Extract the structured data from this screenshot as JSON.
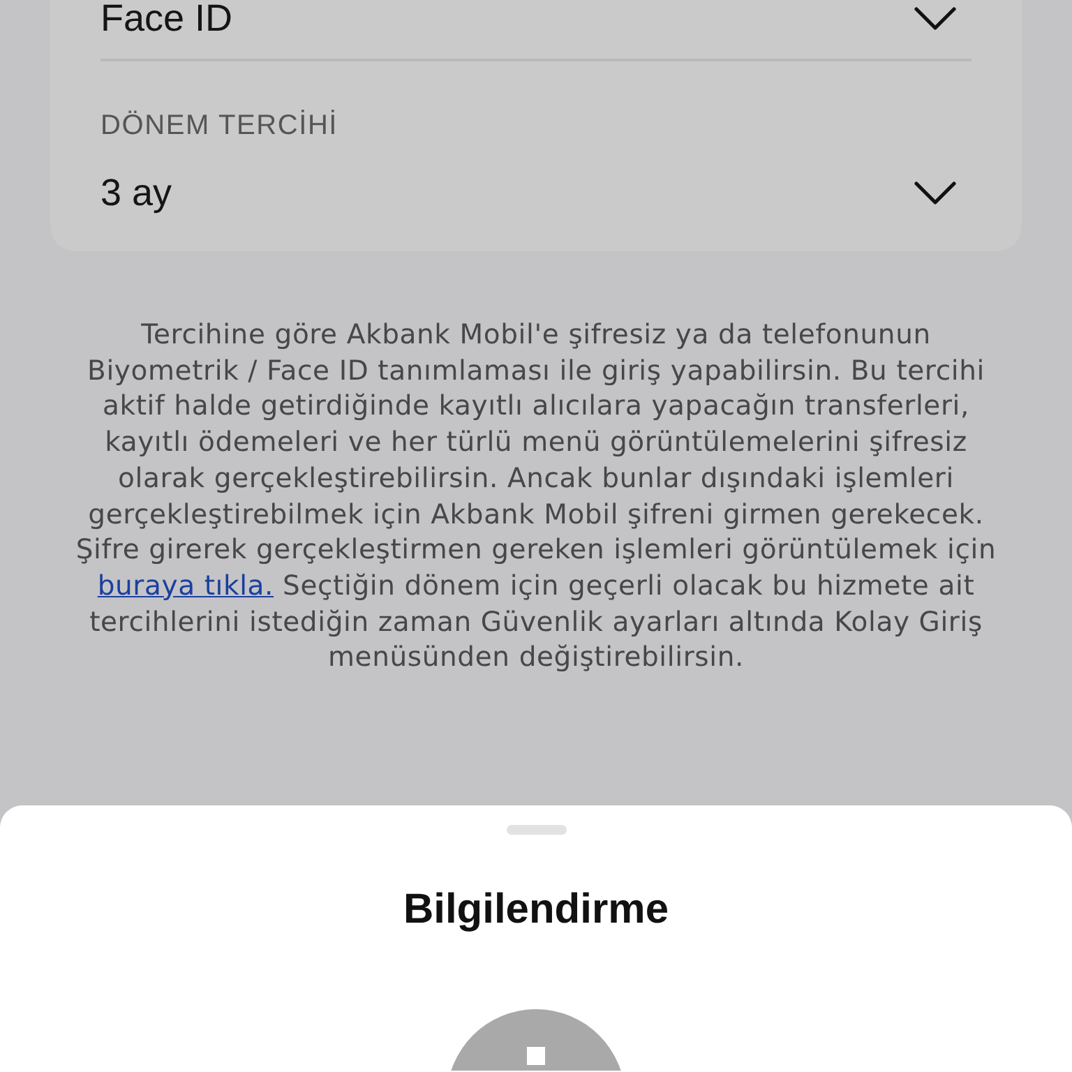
{
  "settings_card": {
    "rows": [
      {
        "value": "Face ID"
      },
      {
        "label": "DÖNEM TERCİHİ",
        "value": "3 ay"
      }
    ]
  },
  "info_text": {
    "before": "Tercihine göre Akbank Mobil'e şifresiz ya da telefonunun Biyometrik / Face ID tanımlaması ile giriş yapabilirsin. Bu tercihi aktif halde getirdiğinde kayıtlı alıcılara yapacağın transferleri, kayıtlı ödemeleri ve her türlü menü görüntülemelerini şifresiz olarak gerçekleştirebilirsin. Ancak bunlar dışındaki işlemleri gerçekleştirebilmek için Akbank Mobil şifreni girmen gerekecek. Şifre girerek gerçekleştirmen gereken işlemleri görüntülemek için",
    "link": "buraya tıkla.",
    "after": "Seçtiğin dönem için geçerli olacak bu hizmete ait tercihlerini istediğin zaman Güvenlik ayarları altında Kolay Giriş menüsünden değiştirebilirsin."
  },
  "bottom_sheet": {
    "title": "Bilgilendirme"
  }
}
